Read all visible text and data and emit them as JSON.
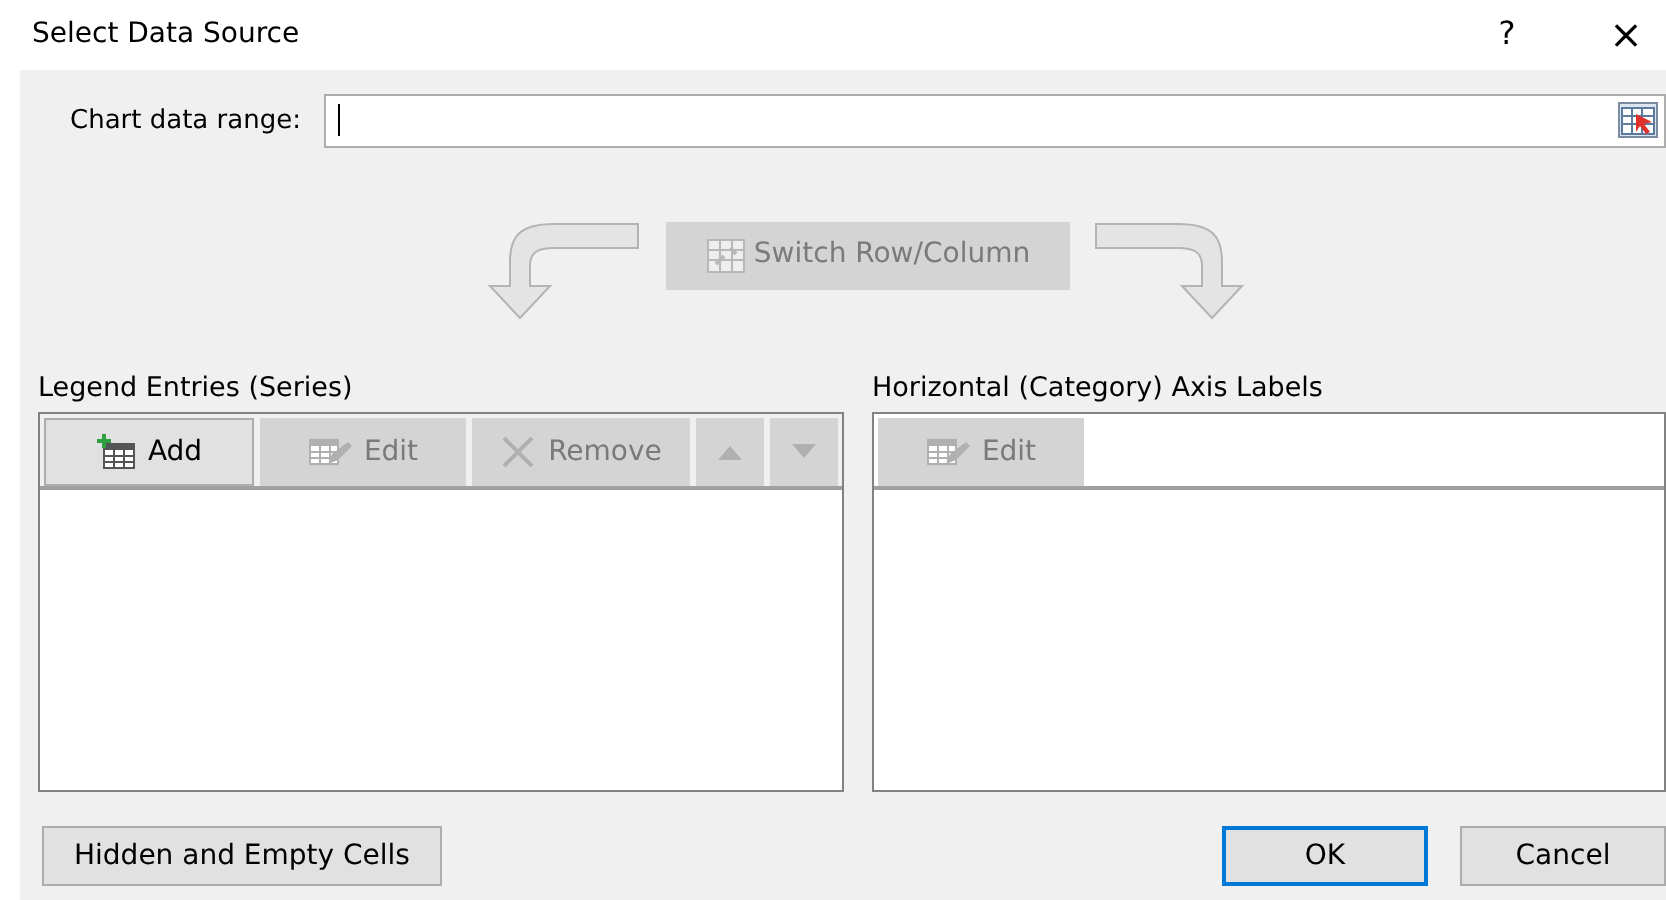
{
  "window": {
    "title": "Select Data Source",
    "help": "?",
    "close": "×"
  },
  "chart_data_range": {
    "label": "Chart data range:",
    "focused": true
  },
  "switch_button": {
    "label": "Switch Row/Column",
    "disabled": true
  },
  "legend_entries": {
    "title": "Legend Entries (Series)",
    "buttons": [
      {
        "kind": "add",
        "label": "Add",
        "disabled": false
      },
      {
        "kind": "edit",
        "label": "Edit",
        "disabled": true
      },
      {
        "kind": "remove",
        "label": "Remove",
        "disabled": true
      },
      {
        "kind": "up",
        "disabled": true
      },
      {
        "kind": "down",
        "disabled": true
      }
    ]
  },
  "axis_labels": {
    "title": "Horizontal (Category) Axis Labels",
    "buttons": [
      {
        "kind": "edit",
        "label": "Edit",
        "disabled": true
      }
    ]
  },
  "footer_buttons": [
    {
      "label": "Hidden and Empty Cells",
      "default": false
    },
    {
      "label": "OK",
      "default": true
    },
    {
      "label": "Cancel",
      "default": false
    }
  ]
}
